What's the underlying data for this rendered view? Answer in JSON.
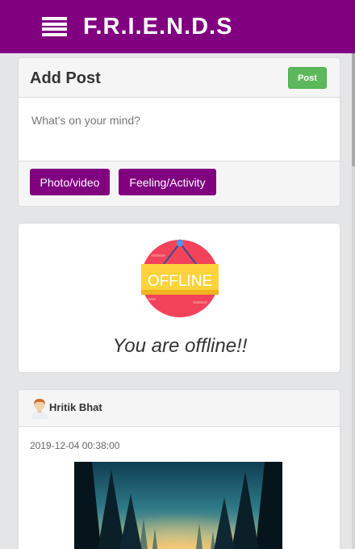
{
  "header": {
    "brand": "F.R.I.E.N.D.S",
    "menu_icon": "hamburger-menu-icon"
  },
  "add_post": {
    "title": "Add Post",
    "post_label": "Post",
    "placeholder": "What's on your mind?",
    "photo_label": "Photo/video",
    "feeling_label": "Feeling/Activity"
  },
  "offline": {
    "sign_text": "OFFLINE",
    "message": "You are offline!!"
  },
  "post": {
    "author": "Hritik Bhat",
    "timestamp": "2019-12-04 00:38:00",
    "avatar_icon": "user-avatar-icon",
    "image": "forest-sunset-image"
  },
  "colors": {
    "brand": "#800080",
    "success": "#5cb85c",
    "offline_red": "#f2435a",
    "offline_yellow": "#fdd33b"
  }
}
